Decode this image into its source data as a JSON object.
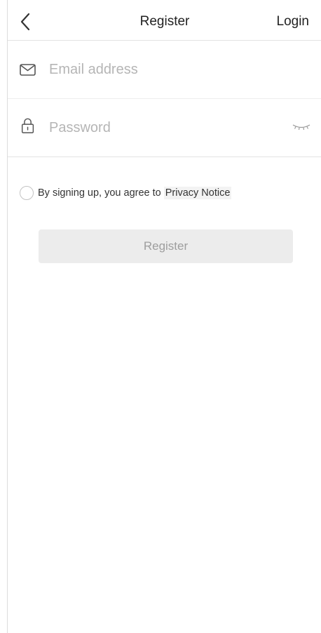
{
  "header": {
    "back_icon": "chevron-left-icon",
    "title": "Register",
    "login_label": "Login"
  },
  "email_field": {
    "icon": "envelope-icon",
    "placeholder": "Email address",
    "value": ""
  },
  "password_field": {
    "icon": "lock-icon",
    "placeholder": "Password",
    "value": "",
    "toggle_icon": "eye-closed-icon"
  },
  "agreement": {
    "checked": false,
    "text": "By signing up, you agree to",
    "link_label": "Privacy Notice"
  },
  "register_button": {
    "label": "Register",
    "enabled": false
  },
  "colors": {
    "placeholder": "#b5b5b5",
    "button_bg": "#ececec",
    "button_text": "#9e9e9e",
    "divider": "#e3e3e3"
  }
}
